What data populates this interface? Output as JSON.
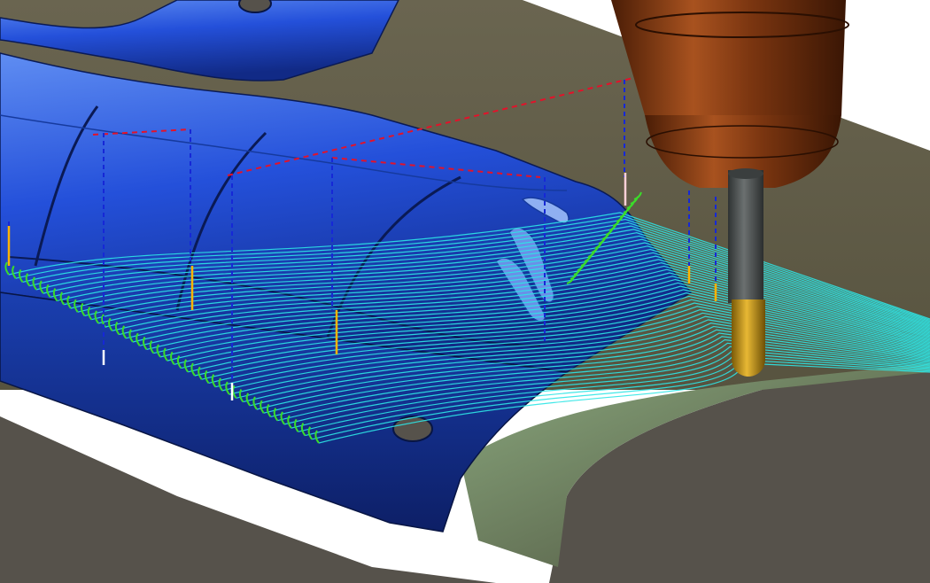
{
  "viewport": {
    "label": ""
  },
  "scene": {
    "description_visible_text": "",
    "colors": {
      "background": "#ffffff",
      "fixture_plate": "#5f5a45",
      "fixture_dark": "#56524b",
      "part_blue": "#1f4fd8",
      "part_blue_dark": "#10246e",
      "part_blue_light": "#5f8df2",
      "toolpath": "#2ee6e6",
      "toolpath_link": "#3bdc2a",
      "rapid_move": "#e3122a",
      "plunge_move": "#1628d6",
      "lead_in": "#ffb300",
      "tool_holder": "#7a3510",
      "tool_shank": "#4c5252",
      "tool_tip": "#c89a1c"
    },
    "icons": [
      "mold-part",
      "toolpath",
      "cutting-tool"
    ]
  }
}
